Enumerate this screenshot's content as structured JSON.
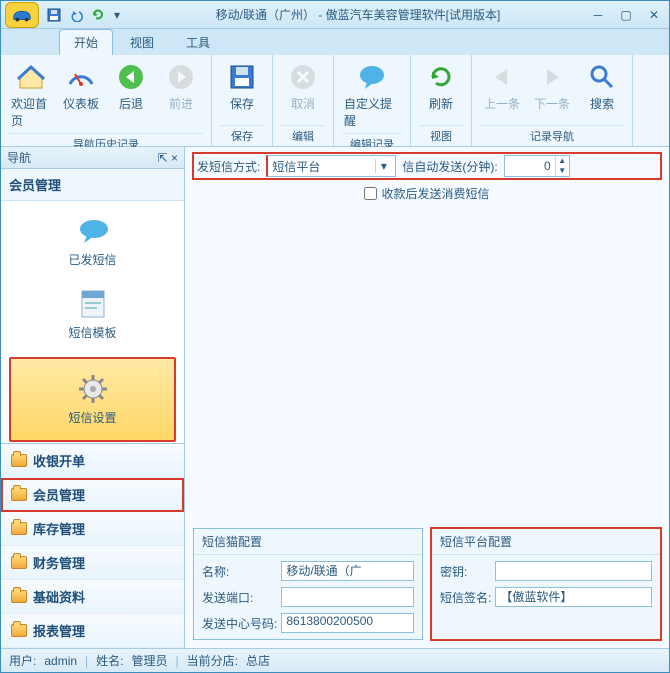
{
  "title": "移动/联通（广州） - 傲蓝汽车美容管理软件[试用版本]",
  "tabs": {
    "start": "开始",
    "view": "视图",
    "tools": "工具"
  },
  "ribbon": {
    "g1": {
      "title": "导航历史记录",
      "home": "欢迎首页",
      "dash": "仪表板",
      "back": "后退",
      "fwd": "前进"
    },
    "g2": {
      "title": "保存",
      "save": "保存"
    },
    "g3": {
      "title": "编辑",
      "cancel": "取消"
    },
    "g4": {
      "title": "编辑记录",
      "remind": "自定义提醒"
    },
    "g5": {
      "title": "视图",
      "refresh": "刷新"
    },
    "g6": {
      "title": "记录导航",
      "prev": "上一条",
      "next": "下一条",
      "search": "搜索"
    }
  },
  "nav": {
    "header": "导航",
    "group_title": "会员管理",
    "items": {
      "sent": "已发短信",
      "tpl": "短信模板",
      "cfg": "短信设置"
    },
    "cats": [
      "收银开单",
      "会员管理",
      "库存管理",
      "财务管理",
      "基础资料",
      "报表管理"
    ]
  },
  "form": {
    "method_label": "发短信方式:",
    "method_value": "短信平台",
    "auto_label": "信自动发送(分钟):",
    "auto_value": "0",
    "chk_label": "收款后发送消费短信"
  },
  "modem": {
    "title": "短信猫配置",
    "name_l": "名称:",
    "name_v": "移动/联通（广",
    "port_l": "发送端口:",
    "port_v": "",
    "center_l": "发送中心号码:",
    "center_v": "8613800200500"
  },
  "platform": {
    "title": "短信平台配置",
    "key_l": "密钥:",
    "key_v": "",
    "sign_l": "短信签名:",
    "sign_v": "【傲蓝软件】"
  },
  "status": {
    "user_l": "用户:",
    "user_v": "admin",
    "name_l": "姓名:",
    "name_v": "管理员",
    "shop_l": "当前分店:",
    "shop_v": "总店"
  }
}
